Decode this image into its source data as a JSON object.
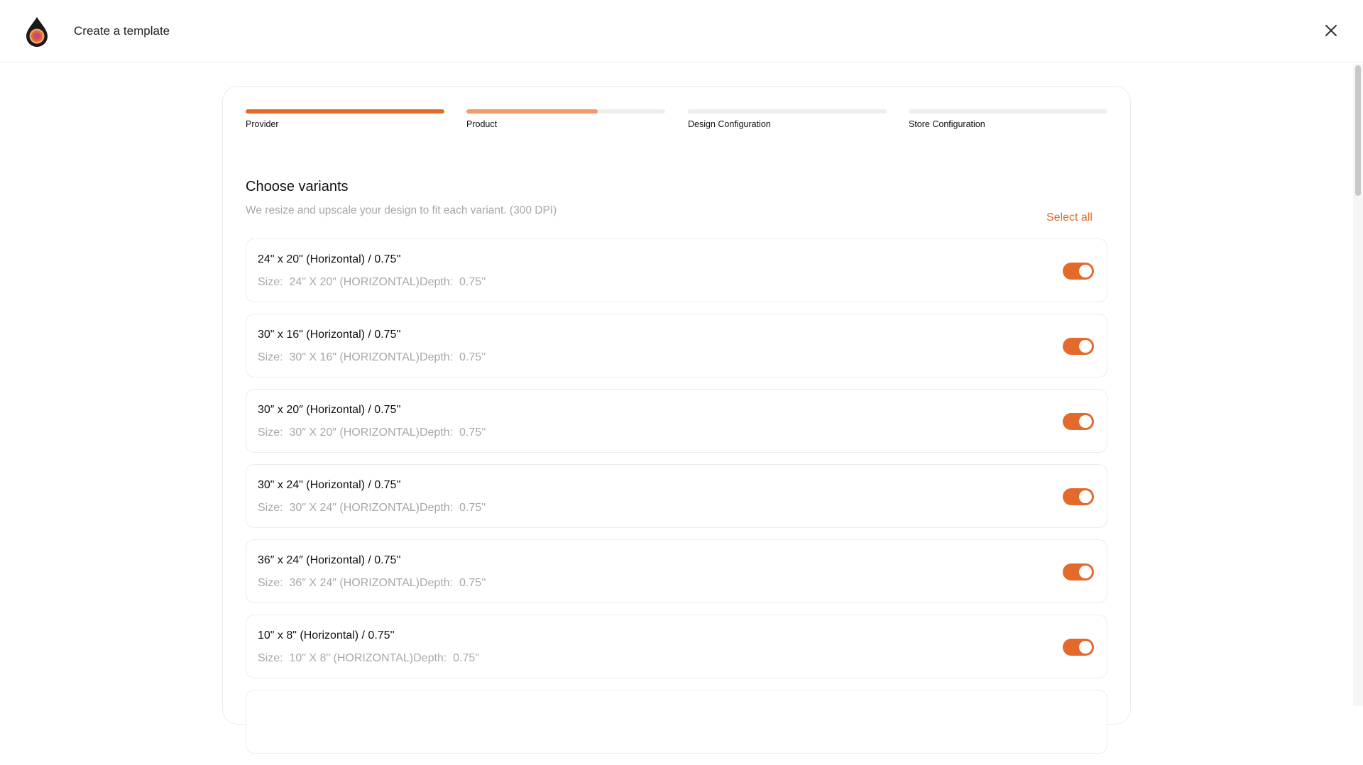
{
  "header": {
    "title": "Create a template"
  },
  "colors": {
    "accent": "#e46a2b",
    "accent_light": "#f09a70",
    "track": "#eeeeee",
    "muted": "#a8a8a8"
  },
  "steps": [
    {
      "label": "Provider",
      "progress": 1.0,
      "color": "#e46a2b"
    },
    {
      "label": "Product",
      "progress": 0.66,
      "color": "#f09a70"
    },
    {
      "label": "Design Configuration",
      "progress": 0,
      "color": "#e46a2b"
    },
    {
      "label": "Store Configuration",
      "progress": 0,
      "color": "#e46a2b"
    }
  ],
  "section": {
    "title": "Choose variants",
    "subtitle": "We resize and upscale your design to fit each variant. (300 DPI)",
    "select_all": "Select all"
  },
  "variants": [
    {
      "name": "24\" x 20\" (Horizontal) / 0.75''",
      "detail": "Size:  24\" X 20\" (HORIZONTAL)Depth:  0.75''",
      "enabled": true
    },
    {
      "name": "30\" x 16\" (Horizontal) / 0.75''",
      "detail": "Size:  30\" X 16\" (HORIZONTAL)Depth:  0.75''",
      "enabled": true
    },
    {
      "name": "30″ x 20″ (Horizontal) / 0.75''",
      "detail": "Size:  30″ X 20″ (HORIZONTAL)Depth:  0.75''",
      "enabled": true
    },
    {
      "name": "30\" x 24\" (Horizontal) / 0.75''",
      "detail": "Size:  30\" X 24\" (HORIZONTAL)Depth:  0.75''",
      "enabled": true
    },
    {
      "name": "36″ x 24″ (Horizontal) / 0.75''",
      "detail": "Size:  36″ X 24″ (HORIZONTAL)Depth:  0.75''",
      "enabled": true
    },
    {
      "name": "10\" x 8\" (Horizontal) / 0.75''",
      "detail": "Size:  10\" X 8\" (HORIZONTAL)Depth:  0.75''",
      "enabled": true
    }
  ]
}
